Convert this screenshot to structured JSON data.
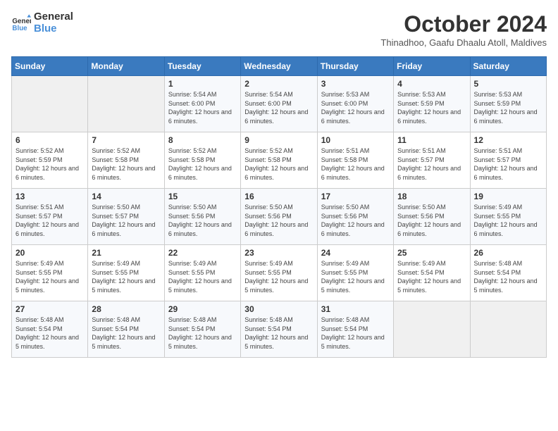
{
  "header": {
    "logo": {
      "line1": "General",
      "line2": "Blue"
    },
    "title": "October 2024",
    "subtitle": "Thinadhoo, Gaafu Dhaalu Atoll, Maldives"
  },
  "weekdays": [
    "Sunday",
    "Monday",
    "Tuesday",
    "Wednesday",
    "Thursday",
    "Friday",
    "Saturday"
  ],
  "weeks": [
    [
      {
        "day": "",
        "info": ""
      },
      {
        "day": "",
        "info": ""
      },
      {
        "day": "1",
        "info": "Sunrise: 5:54 AM\nSunset: 6:00 PM\nDaylight: 12 hours and 6 minutes."
      },
      {
        "day": "2",
        "info": "Sunrise: 5:54 AM\nSunset: 6:00 PM\nDaylight: 12 hours and 6 minutes."
      },
      {
        "day": "3",
        "info": "Sunrise: 5:53 AM\nSunset: 6:00 PM\nDaylight: 12 hours and 6 minutes."
      },
      {
        "day": "4",
        "info": "Sunrise: 5:53 AM\nSunset: 5:59 PM\nDaylight: 12 hours and 6 minutes."
      },
      {
        "day": "5",
        "info": "Sunrise: 5:53 AM\nSunset: 5:59 PM\nDaylight: 12 hours and 6 minutes."
      }
    ],
    [
      {
        "day": "6",
        "info": "Sunrise: 5:52 AM\nSunset: 5:59 PM\nDaylight: 12 hours and 6 minutes."
      },
      {
        "day": "7",
        "info": "Sunrise: 5:52 AM\nSunset: 5:58 PM\nDaylight: 12 hours and 6 minutes."
      },
      {
        "day": "8",
        "info": "Sunrise: 5:52 AM\nSunset: 5:58 PM\nDaylight: 12 hours and 6 minutes."
      },
      {
        "day": "9",
        "info": "Sunrise: 5:52 AM\nSunset: 5:58 PM\nDaylight: 12 hours and 6 minutes."
      },
      {
        "day": "10",
        "info": "Sunrise: 5:51 AM\nSunset: 5:58 PM\nDaylight: 12 hours and 6 minutes."
      },
      {
        "day": "11",
        "info": "Sunrise: 5:51 AM\nSunset: 5:57 PM\nDaylight: 12 hours and 6 minutes."
      },
      {
        "day": "12",
        "info": "Sunrise: 5:51 AM\nSunset: 5:57 PM\nDaylight: 12 hours and 6 minutes."
      }
    ],
    [
      {
        "day": "13",
        "info": "Sunrise: 5:51 AM\nSunset: 5:57 PM\nDaylight: 12 hours and 6 minutes."
      },
      {
        "day": "14",
        "info": "Sunrise: 5:50 AM\nSunset: 5:57 PM\nDaylight: 12 hours and 6 minutes."
      },
      {
        "day": "15",
        "info": "Sunrise: 5:50 AM\nSunset: 5:56 PM\nDaylight: 12 hours and 6 minutes."
      },
      {
        "day": "16",
        "info": "Sunrise: 5:50 AM\nSunset: 5:56 PM\nDaylight: 12 hours and 6 minutes."
      },
      {
        "day": "17",
        "info": "Sunrise: 5:50 AM\nSunset: 5:56 PM\nDaylight: 12 hours and 6 minutes."
      },
      {
        "day": "18",
        "info": "Sunrise: 5:50 AM\nSunset: 5:56 PM\nDaylight: 12 hours and 6 minutes."
      },
      {
        "day": "19",
        "info": "Sunrise: 5:49 AM\nSunset: 5:55 PM\nDaylight: 12 hours and 6 minutes."
      }
    ],
    [
      {
        "day": "20",
        "info": "Sunrise: 5:49 AM\nSunset: 5:55 PM\nDaylight: 12 hours and 5 minutes."
      },
      {
        "day": "21",
        "info": "Sunrise: 5:49 AM\nSunset: 5:55 PM\nDaylight: 12 hours and 5 minutes."
      },
      {
        "day": "22",
        "info": "Sunrise: 5:49 AM\nSunset: 5:55 PM\nDaylight: 12 hours and 5 minutes."
      },
      {
        "day": "23",
        "info": "Sunrise: 5:49 AM\nSunset: 5:55 PM\nDaylight: 12 hours and 5 minutes."
      },
      {
        "day": "24",
        "info": "Sunrise: 5:49 AM\nSunset: 5:55 PM\nDaylight: 12 hours and 5 minutes."
      },
      {
        "day": "25",
        "info": "Sunrise: 5:49 AM\nSunset: 5:54 PM\nDaylight: 12 hours and 5 minutes."
      },
      {
        "day": "26",
        "info": "Sunrise: 5:48 AM\nSunset: 5:54 PM\nDaylight: 12 hours and 5 minutes."
      }
    ],
    [
      {
        "day": "27",
        "info": "Sunrise: 5:48 AM\nSunset: 5:54 PM\nDaylight: 12 hours and 5 minutes."
      },
      {
        "day": "28",
        "info": "Sunrise: 5:48 AM\nSunset: 5:54 PM\nDaylight: 12 hours and 5 minutes."
      },
      {
        "day": "29",
        "info": "Sunrise: 5:48 AM\nSunset: 5:54 PM\nDaylight: 12 hours and 5 minutes."
      },
      {
        "day": "30",
        "info": "Sunrise: 5:48 AM\nSunset: 5:54 PM\nDaylight: 12 hours and 5 minutes."
      },
      {
        "day": "31",
        "info": "Sunrise: 5:48 AM\nSunset: 5:54 PM\nDaylight: 12 hours and 5 minutes."
      },
      {
        "day": "",
        "info": ""
      },
      {
        "day": "",
        "info": ""
      }
    ]
  ]
}
